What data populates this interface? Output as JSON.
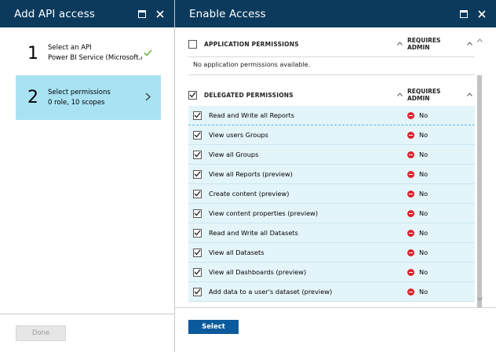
{
  "left_blade": {
    "title": "Add API access",
    "steps": [
      {
        "number": "1",
        "title": "Select an API",
        "subtitle": "Power BI Service (Microsoft.Az..."
      },
      {
        "number": "2",
        "title": "Select permissions",
        "subtitle": "0 role, 10 scopes"
      }
    ],
    "done_label": "Done"
  },
  "right_blade": {
    "title": "Enable Access",
    "application_section": {
      "label": "APPLICATION PERMISSIONS",
      "requires_admin_label": "REQUIRES ADMIN",
      "empty_text": "No application permissions available."
    },
    "delegated_section": {
      "label": "DELEGATED PERMISSIONS",
      "requires_admin_label": "REQUIRES ADMIN"
    },
    "permissions": [
      {
        "name": "Read and Write all Reports",
        "requires_admin": "No"
      },
      {
        "name": "View users Groups",
        "requires_admin": "No"
      },
      {
        "name": "View all Groups",
        "requires_admin": "No"
      },
      {
        "name": "View all Reports (preview)",
        "requires_admin": "No"
      },
      {
        "name": "Create content (preview)",
        "requires_admin": "No"
      },
      {
        "name": "View content properties (preview)",
        "requires_admin": "No"
      },
      {
        "name": "Read and Write all Datasets",
        "requires_admin": "No"
      },
      {
        "name": "View all Datasets",
        "requires_admin": "No"
      },
      {
        "name": "View all Dashboards (preview)",
        "requires_admin": "No"
      },
      {
        "name": "Add data to a user's dataset (preview)",
        "requires_admin": "No"
      }
    ],
    "select_label": "Select"
  },
  "colors": {
    "header_bg": "#0b3a5c",
    "active_step_bg": "#a9e2f3",
    "row_bg": "#e4f5fa",
    "primary_button": "#0a5a9c",
    "deny_icon": "#d9232d",
    "check_green": "#6fb43f"
  },
  "icons": {
    "maximize": "maximize-icon",
    "close": "close-icon",
    "check": "checkmark-icon",
    "chevron": "chevron-right-icon",
    "sort": "caret-up-icon",
    "deny": "no-entry-icon"
  }
}
